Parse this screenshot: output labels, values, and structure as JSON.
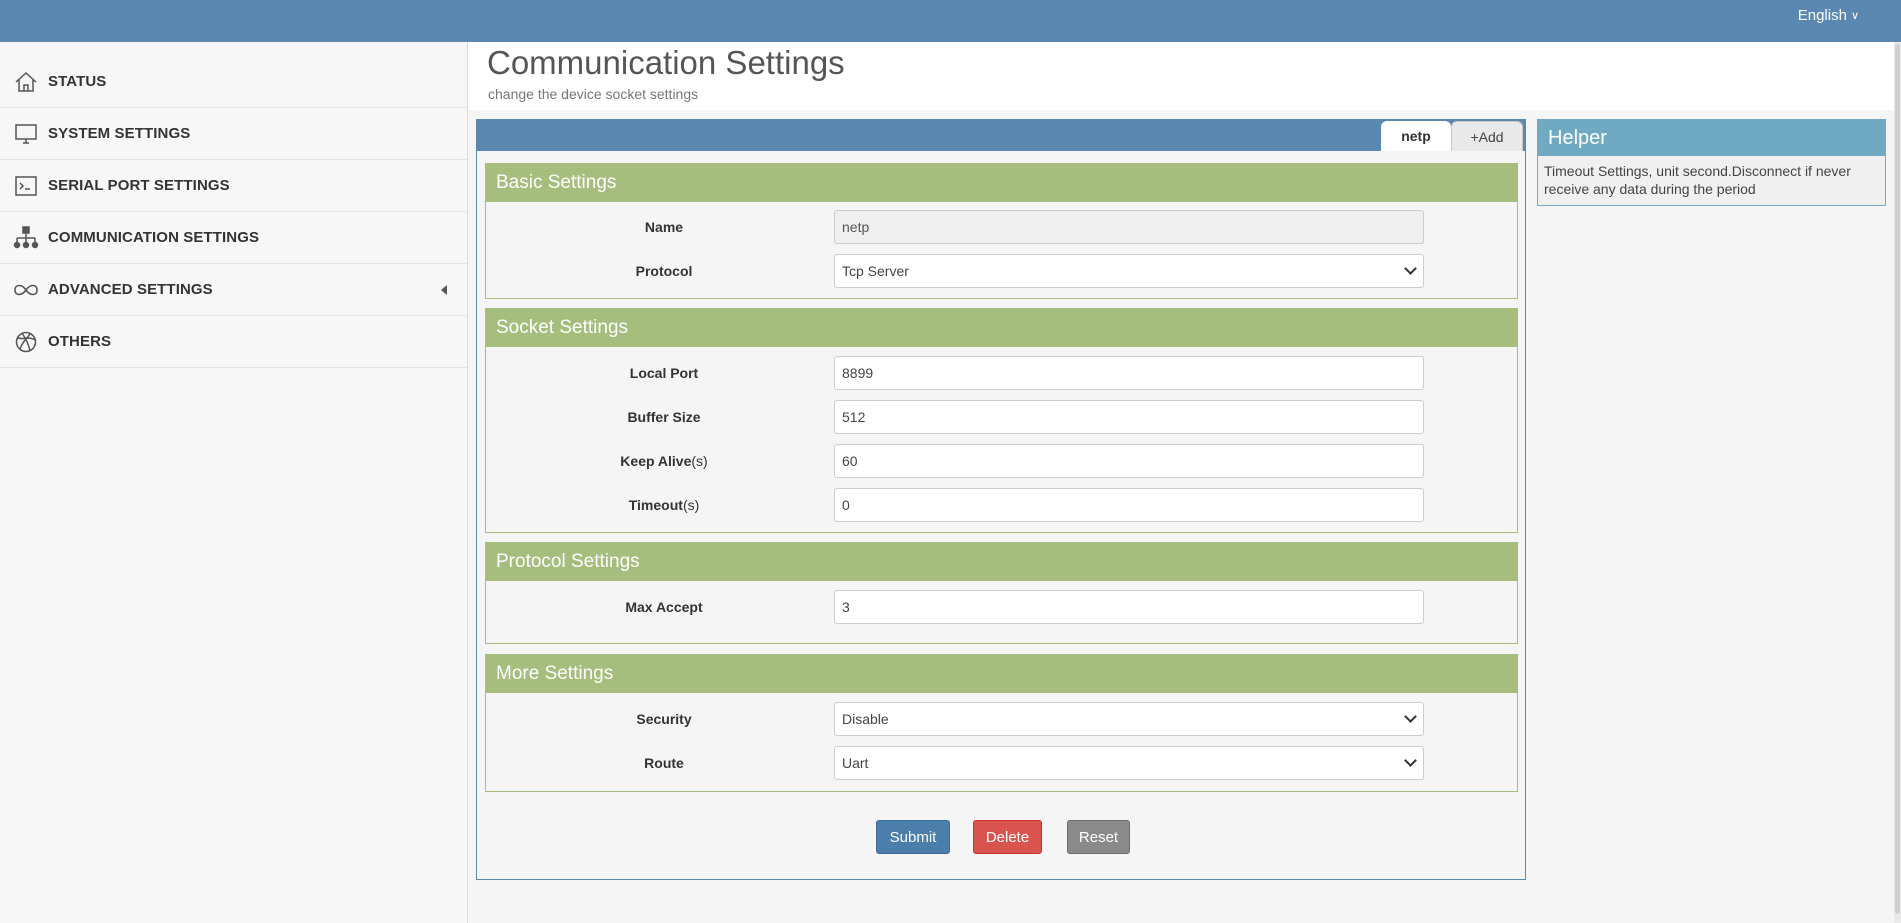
{
  "topbar": {
    "language": "English"
  },
  "sidebar": {
    "items": [
      {
        "label": "STATUS",
        "icon": "home-icon"
      },
      {
        "label": "SYSTEM SETTINGS",
        "icon": "monitor-icon"
      },
      {
        "label": "SERIAL PORT SETTINGS",
        "icon": "terminal-icon"
      },
      {
        "label": "COMMUNICATION SETTINGS",
        "icon": "network-icon"
      },
      {
        "label": "ADVANCED SETTINGS",
        "icon": "infinity-icon",
        "expandable": true
      },
      {
        "label": "OTHERS",
        "icon": "globe-icon"
      }
    ]
  },
  "header": {
    "title": "Communication Settings",
    "subtitle": "change the device socket settings"
  },
  "tabs": {
    "active": "netp",
    "add": "+Add"
  },
  "basic": {
    "title": "Basic Settings",
    "name_label": "Name",
    "name_value": "netp",
    "protocol_label": "Protocol",
    "protocol_value": "Tcp Server"
  },
  "socket": {
    "title": "Socket Settings",
    "local_port_label": "Local Port",
    "local_port_value": "8899",
    "buffer_size_label": "Buffer Size",
    "buffer_size_value": "512",
    "keep_alive_label": "Keep Alive",
    "keep_alive_unit": "(s)",
    "keep_alive_value": "60",
    "timeout_label": "Timeout",
    "timeout_unit": "(s)",
    "timeout_value": "0"
  },
  "protocol": {
    "title": "Protocol Settings",
    "max_accept_label": "Max Accept",
    "max_accept_value": "3"
  },
  "more": {
    "title": "More Settings",
    "security_label": "Security",
    "security_value": "Disable",
    "route_label": "Route",
    "route_value": "Uart"
  },
  "actions": {
    "submit": "Submit",
    "delete": "Delete",
    "reset": "Reset"
  },
  "helper": {
    "title": "Helper",
    "text": "Timeout Settings, unit second.Disconnect if never receive any data during the period"
  },
  "colors": {
    "topbar": "#5a88b0",
    "section_header": "#a5bd7d",
    "helper_header": "#6faac2",
    "submit": "#4c7eab",
    "delete": "#d9534f",
    "reset": "#8a8a8a"
  }
}
